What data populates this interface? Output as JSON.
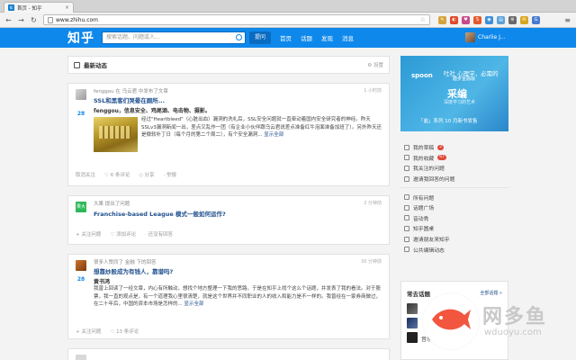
{
  "browser": {
    "tab_title": "首页 - 知乎",
    "tab_favicon": "知",
    "url": "www.zhihu.com"
  },
  "header": {
    "logo": "知乎",
    "search_placeholder": "搜索话题、问题或人...",
    "ask_button": "提问",
    "nav": [
      "首页",
      "话题",
      "发现",
      "消息"
    ],
    "user_name": "Charlie J..."
  },
  "feed": {
    "title": "最新动态",
    "settings": "设置",
    "items": [
      {
        "source": "fenggou 在 乌云君 中发布了文章",
        "time": "1 小时前",
        "title": "SSL和黑客们哭晕在厕所...",
        "votes": "28",
        "author": "fenggou，信息安全、鸡尾酒、电击物、摄影。",
        "body": "经过\"Heartbleed\"（心脏出血）漏洞的洗礼后，SSL安全问题就一直牵动着国内安全研究者的神经。昨天SSLv3漏洞新闻一出，差点又乱作一团（有企业小伙伴跟乌云君说差点准备红牛泡面准备加班了）。另外昨天还是微软补丁日（每个月的第二个周二），有个安全漏洞...",
        "show_all": "显示全部",
        "actions": [
          "取消关注",
          "6 条评论",
          "分享",
          "举报"
        ]
      },
      {
        "source": "大果 提出了问题",
        "time": "2 分钟前",
        "title": "Franchise-based League 模式一般如何运作?",
        "actions": [
          "关注问题",
          "添加评论",
          "还没有回答"
        ]
      },
      {
        "source": "很多人赞同了 金融 下的回答",
        "time": "30 分钟前",
        "title": "想靠炒股成为有钱人，靠谱吗?",
        "votes": "28",
        "author": "黄书鸿",
        "body": "我曾上回读了一经文章，内心有所触动，想找个地方整理一下我的思路。于是在知乎上找个这么个话题，并发表了我的看法。对于股票，我一直的观点是，有一个道理我心里很清楚，就是这个世界并不同职业的人的收入和能力是不一样的。我曾经在一家券商做过，在二十年后，中国的资本市场是怎样的...",
        "show_all": "显示全部",
        "actions": [
          "关注问题",
          "13 条评论"
        ]
      }
    ]
  },
  "sidebar": {
    "ad": {
      "brand": "spoon",
      "line1": "吐社 心理学，必需的",
      "line2": "趣步金融版",
      "big": "采编",
      "line3": "深度学习的艺术",
      "footer": "「盐」系列 10 月新书发售"
    },
    "menu_top": [
      {
        "label": "我的草稿",
        "badge": "2"
      },
      {
        "label": "我的收藏",
        "badge": "67"
      },
      {
        "label": "我关注的问题",
        "badge": ""
      },
      {
        "label": "邀请我回答的问题",
        "badge": ""
      }
    ],
    "menu_bottom": [
      {
        "label": "所有问题"
      },
      {
        "label": "话题广场"
      },
      {
        "label": "音动秀"
      },
      {
        "label": "知乎圆桌"
      },
      {
        "label": "邀请朋友来知乎"
      },
      {
        "label": "公共编辑动态"
      }
    ],
    "hot_topics": {
      "title": "常去话题",
      "all": "全部话题 »",
      "topics": [
        "",
        "",
        "音乐"
      ]
    }
  },
  "watermark": {
    "text": "网多鱼",
    "url": "wduoyu.com"
  }
}
